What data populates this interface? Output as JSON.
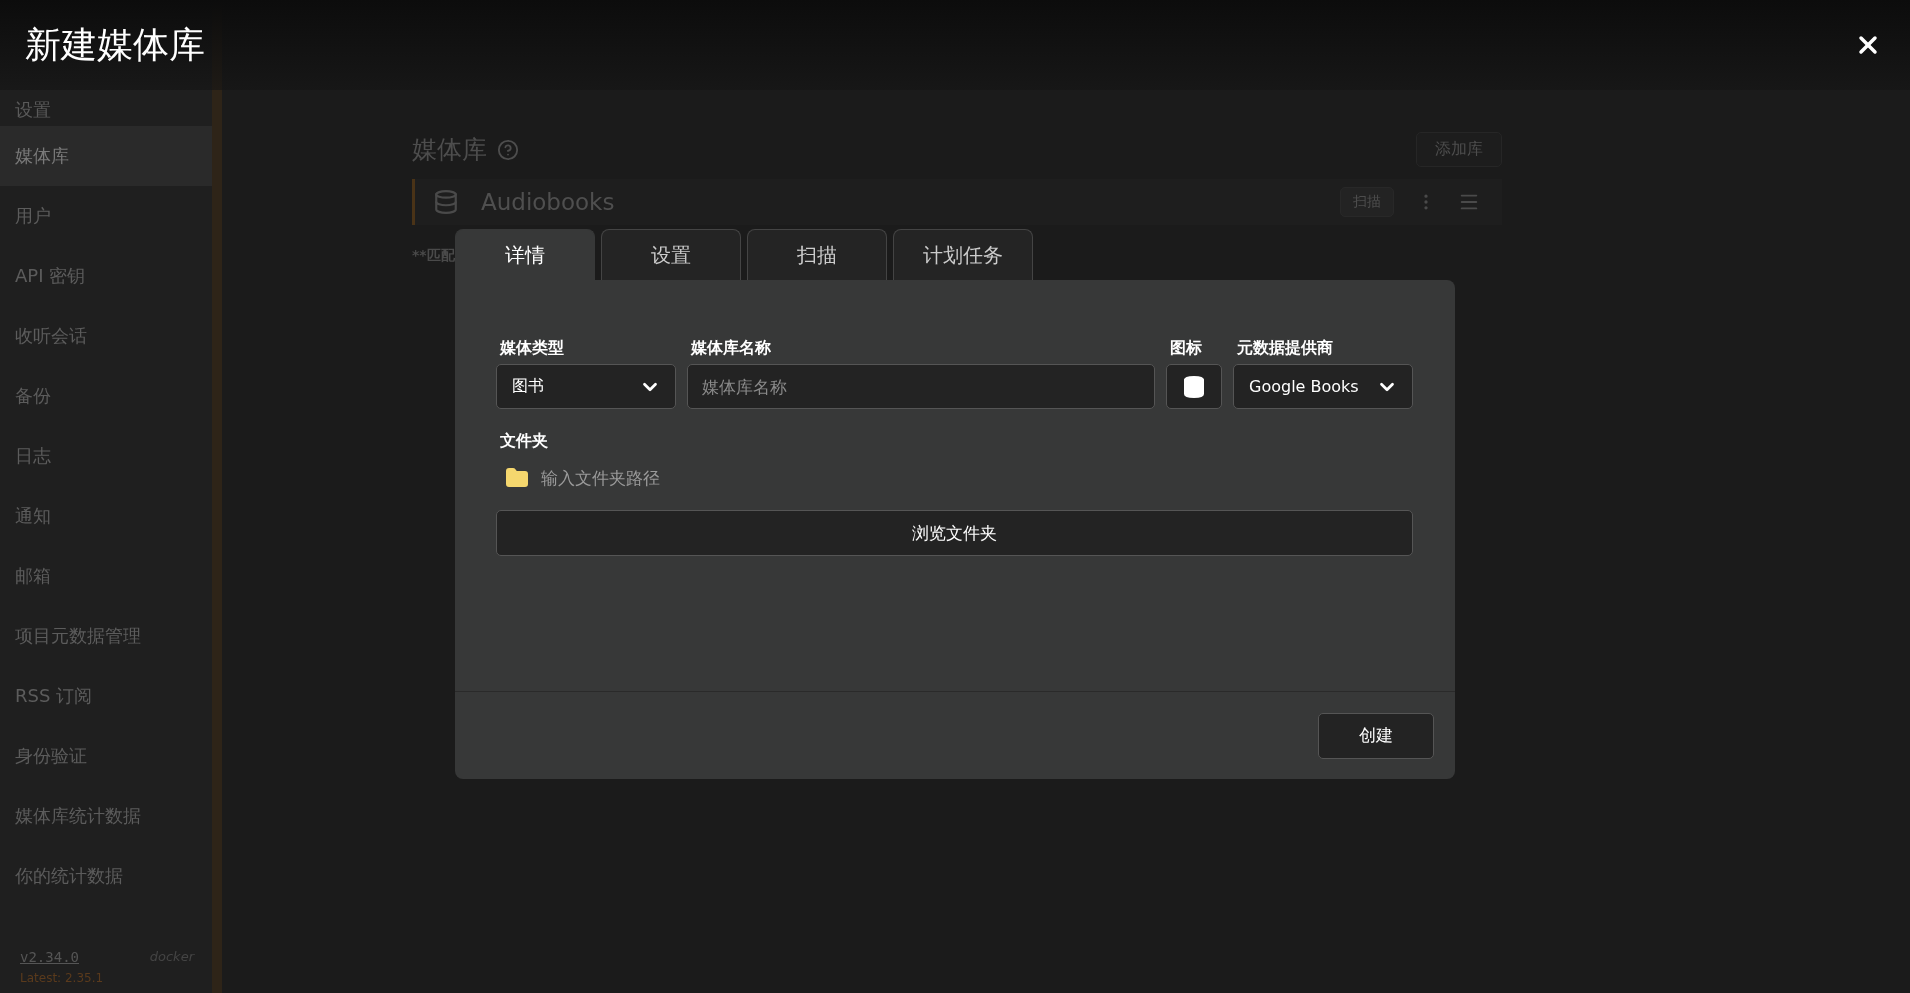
{
  "dialog": {
    "title": "新建媒体库",
    "tabs": [
      {
        "label": "详情",
        "selected": true
      },
      {
        "label": "设置",
        "selected": false
      },
      {
        "label": "扫描",
        "selected": false
      },
      {
        "label": "计划任务",
        "selected": false
      }
    ],
    "media_type": {
      "label": "媒体类型",
      "value": "图书"
    },
    "name": {
      "label": "媒体库名称",
      "placeholder": "媒体库名称"
    },
    "icon": {
      "label": "图标"
    },
    "provider": {
      "label": "元数据提供商",
      "value": "Google Books"
    },
    "folders": {
      "label": "文件夹",
      "placeholder": "输入文件夹路径"
    },
    "browse_button": "浏览文件夹",
    "create_button": "创建"
  },
  "sidebar": {
    "header": "设置",
    "items": [
      {
        "label": "媒体库",
        "selected": true
      },
      {
        "label": "用户",
        "selected": false
      },
      {
        "label": "API 密钥",
        "selected": false
      },
      {
        "label": "收听会话",
        "selected": false
      },
      {
        "label": "备份",
        "selected": false
      },
      {
        "label": "日志",
        "selected": false
      },
      {
        "label": "通知",
        "selected": false
      },
      {
        "label": "邮箱",
        "selected": false
      },
      {
        "label": "项目元数据管理",
        "selected": false
      },
      {
        "label": "RSS 订阅",
        "selected": false
      },
      {
        "label": "身份验证",
        "selected": false
      },
      {
        "label": "媒体库统计数据",
        "selected": false
      },
      {
        "label": "你的统计数据",
        "selected": false
      }
    ],
    "version": "v2.34.0",
    "build": "docker",
    "latest": "Latest: 2.35.1"
  },
  "page": {
    "title": "媒体库",
    "add_button": "添加库",
    "libraries": [
      {
        "name": "Audiobooks",
        "scan_button": "扫描"
      }
    ],
    "note": "**匹配"
  }
}
